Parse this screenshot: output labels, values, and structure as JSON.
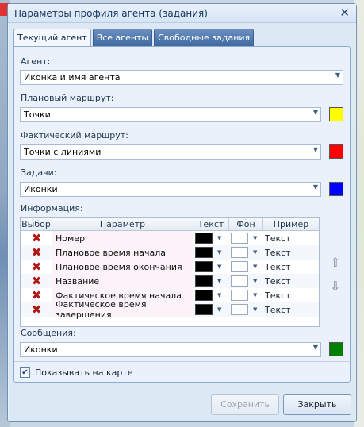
{
  "window": {
    "title": "Параметры профиля агента (задания)"
  },
  "tabs": [
    {
      "label": "Текущий агент"
    },
    {
      "label": "Все агенты"
    },
    {
      "label": "Свободные задания"
    }
  ],
  "agent": {
    "label": "Агент:",
    "value": "Иконка и имя агента"
  },
  "planned_route": {
    "label": "Плановый маршрут:",
    "value": "Точки",
    "color": "#ffff00"
  },
  "actual_route": {
    "label": "Фактический маршрут:",
    "value": "Точки с линиями",
    "color": "#ff0000"
  },
  "tasks": {
    "label": "Задачи:",
    "value": "Иконки",
    "color": "#0000ff"
  },
  "info": {
    "label": "Информация:",
    "columns": [
      "Выбор",
      "Параметр",
      "Текст",
      "Фон",
      "Пример"
    ],
    "rows": [
      {
        "param": "Номер",
        "sample": "Текст"
      },
      {
        "param": "Плановое время начала",
        "sample": "Текст"
      },
      {
        "param": "Плановое время окончания",
        "sample": "Текст"
      },
      {
        "param": "Название",
        "sample": "Текст"
      },
      {
        "param": "Фактическое время начала",
        "sample": "Текст"
      },
      {
        "param": "Фактическое время завершения",
        "sample": "Текст"
      }
    ],
    "text_color": "#000000",
    "bg_color": "#ffffff"
  },
  "messages": {
    "label": "Сообщения:",
    "value": "Иконки",
    "color": "#008000"
  },
  "show_on_map": {
    "label": "Показывать на карте",
    "checked": true
  },
  "buttons": {
    "save": "Сохранить",
    "close": "Закрыть"
  },
  "icons": {
    "close": "close-icon",
    "remove": "x-icon",
    "up": "arrow-up-icon",
    "down": "arrow-down-icon"
  }
}
